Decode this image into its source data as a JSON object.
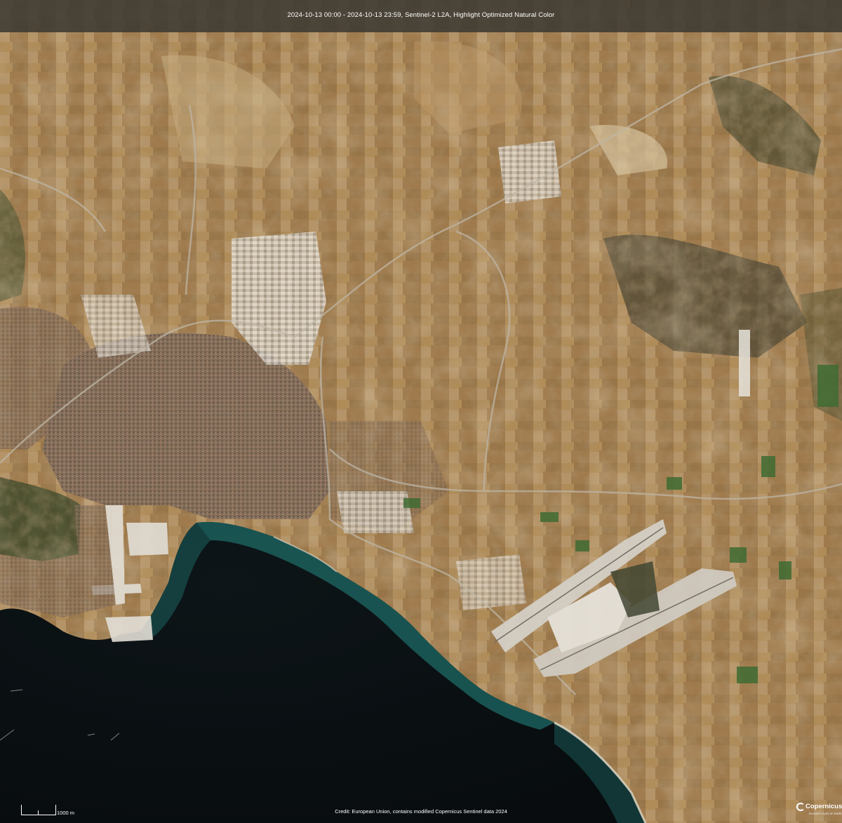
{
  "header": {
    "caption": "2024-10-13 00:00 - 2024-10-13 23:59, Sentinel-2 L2A, Highlight Optimized Natural Color"
  },
  "footer": {
    "credit": "Credit: European Union, contains modified Copernicus Sentinel data 2024",
    "scale_label": "1000 m",
    "brand_name": "Copernicus",
    "brand_sub": "Europe's eyes on Earth"
  },
  "colors": {
    "land_base": "#a47f4f",
    "land_dark": "#6e5534",
    "land_light": "#c8ad82",
    "sea_deep": "#0b1114",
    "sea_shallow": "#1f6b68",
    "city": "#7b6a5a",
    "roads": "#b9b1a2",
    "header_bg": "#3a3832"
  },
  "icons": {
    "scale": "scale-bar-icon",
    "brand": "copernicus-logo-icon"
  }
}
